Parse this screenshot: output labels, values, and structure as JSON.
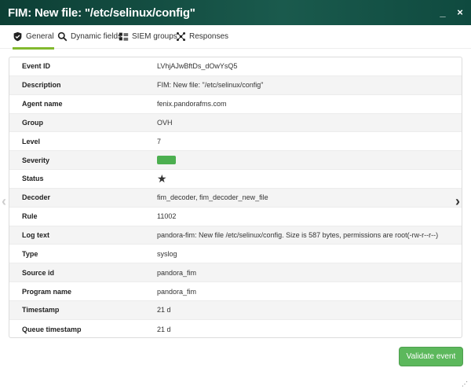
{
  "window": {
    "title": "FIM: New file: \"/etc/selinux/config\"",
    "minimize_glyph": "_",
    "close_glyph": "×"
  },
  "tabs": [
    {
      "label": "General",
      "icon": "shield-icon",
      "active": true
    },
    {
      "label": "Dynamic fields",
      "icon": "magnifier-icon",
      "active": false
    },
    {
      "label": "SIEM groups",
      "icon": "grid-list-icon",
      "active": false
    },
    {
      "label": "Responses",
      "icon": "network-icon",
      "active": false
    }
  ],
  "details": [
    {
      "label": "Event ID",
      "value": "LVhjAJwBftDs_dOwYsQ5"
    },
    {
      "label": "Description",
      "value": "FIM: New file: \"/etc/selinux/config\""
    },
    {
      "label": "Agent name",
      "value": "fenix.pandorafms.com"
    },
    {
      "label": "Group",
      "value": "OVH"
    },
    {
      "label": "Level",
      "value": "7"
    },
    {
      "label": "Severity",
      "value": "",
      "color": "#4caf50"
    },
    {
      "label": "Status",
      "value": "★"
    },
    {
      "label": "Decoder",
      "value": "fim_decoder, fim_decoder_new_file"
    },
    {
      "label": "Rule",
      "value": "11002"
    },
    {
      "label": "Log text",
      "value": "pandora-fim: New file /etc/selinux/config. Size is 587 bytes, permissions are root(-rw-r--r--)"
    },
    {
      "label": "Type",
      "value": "syslog"
    },
    {
      "label": "Source id",
      "value": "pandora_fim"
    },
    {
      "label": "Program name",
      "value": "pandora_fim"
    },
    {
      "label": "Timestamp",
      "value": "21 d"
    },
    {
      "label": "Queue timestamp",
      "value": "21 d"
    }
  ],
  "nav": {
    "prev_glyph": "‹",
    "next_glyph": "›"
  },
  "actions": {
    "validate_label": "Validate event"
  },
  "colors": {
    "header": "#0d3f35",
    "accent": "#82b92e",
    "button": "#5cb85c"
  }
}
